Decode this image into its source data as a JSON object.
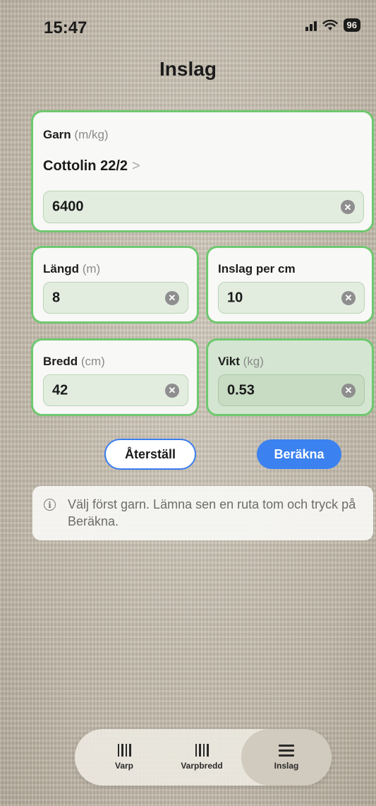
{
  "status": {
    "time": "15:47",
    "battery": "96"
  },
  "title": "Inslag",
  "yarn_card": {
    "label": "Garn",
    "unit": "(m/kg)",
    "yarn_name": "Cottolin 22/2",
    "value": "6400"
  },
  "length": {
    "label": "Längd",
    "unit": "(m)",
    "value": "8"
  },
  "weft_per_cm": {
    "label": "Inslag per cm",
    "value": "10"
  },
  "width": {
    "label": "Bredd",
    "unit": "(cm)",
    "value": "42"
  },
  "weight": {
    "label": "Vikt",
    "unit": "(kg)",
    "value": "0.53"
  },
  "buttons": {
    "reset": "Återställ",
    "calculate": "Beräkna"
  },
  "info": {
    "text": "Välj först garn. Lämna sen en ruta tom och tryck på Beräkna."
  },
  "tabs": [
    {
      "label": "Varp",
      "icon": "warp-bars-icon"
    },
    {
      "label": "Varpbredd",
      "icon": "warp-width-bars-icon"
    },
    {
      "label": "Inslag",
      "icon": "weft-lines-icon"
    }
  ],
  "colors": {
    "accent_green": "#6fc86f",
    "button_blue": "#3b82f0"
  }
}
